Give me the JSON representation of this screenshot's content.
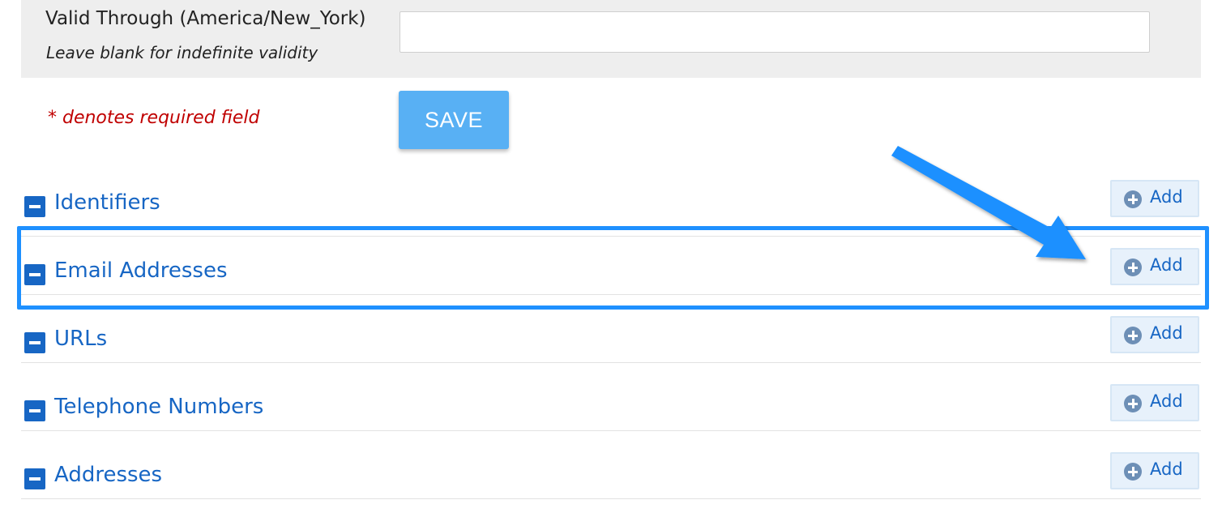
{
  "valid_through": {
    "label": "Valid Through (America/New_York)",
    "hint": "Leave blank for indefinite validity",
    "value": "",
    "placeholder": ""
  },
  "required_note": "* denotes required field",
  "save_label": "SAVE",
  "sections": [
    {
      "title": "Identifiers",
      "add_label": "Add"
    },
    {
      "title": "Email Addresses",
      "add_label": "Add"
    },
    {
      "title": "URLs",
      "add_label": "Add"
    },
    {
      "title": "Telephone Numbers",
      "add_label": "Add"
    },
    {
      "title": "Addresses",
      "add_label": "Add"
    }
  ],
  "colors": {
    "link_blue": "#1766c4",
    "save_button": "#58b0f4",
    "required_red": "#c00000",
    "annotation_blue": "#1e90ff"
  }
}
